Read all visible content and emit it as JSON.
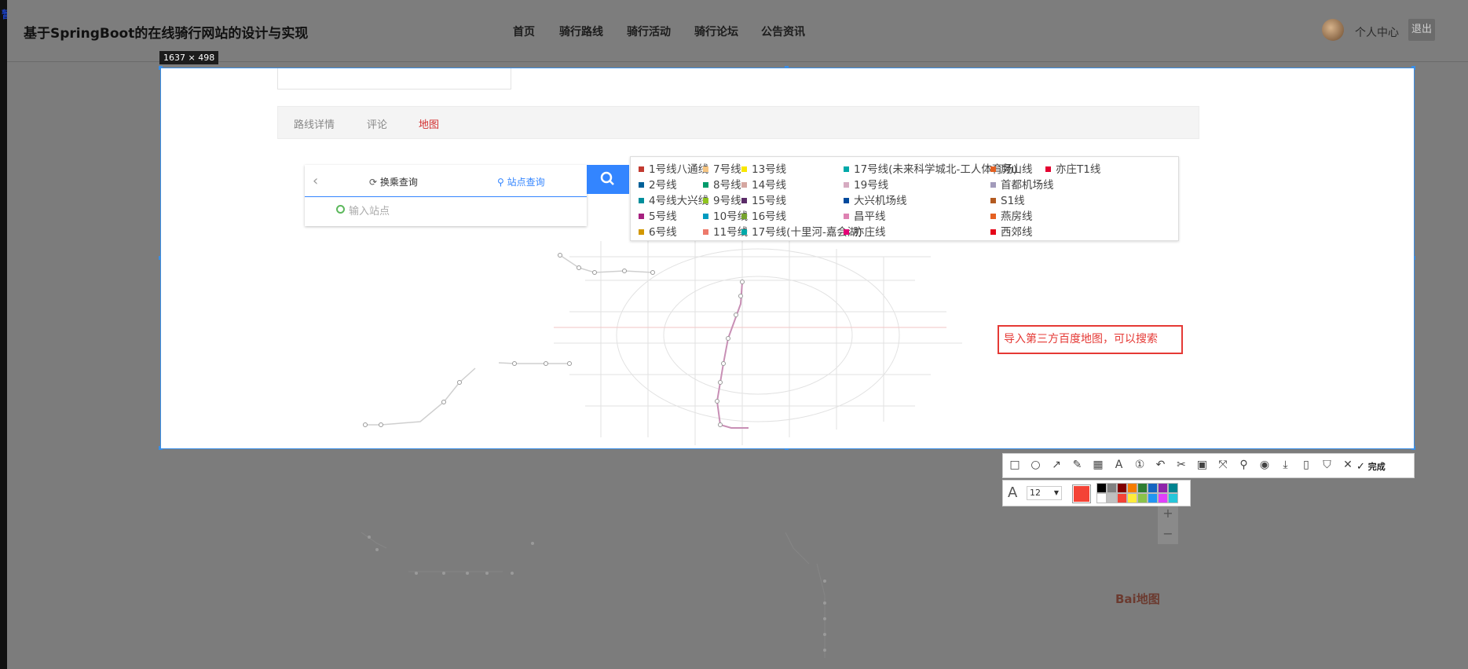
{
  "overlay": {
    "pause_label": "暂停",
    "selection_size": "1637 × 498"
  },
  "header": {
    "site_title": "基于SpringBoot的在线骑行网站的设计与实现",
    "nav": [
      "首页",
      "骑行路线",
      "骑行活动",
      "骑行论坛",
      "公告资讯"
    ],
    "user_center": "个人中心",
    "logout": "退出"
  },
  "detail_tabs": [
    {
      "label": "路线详情",
      "active": false
    },
    {
      "label": "评论",
      "active": false
    },
    {
      "label": "地图",
      "active": true
    }
  ],
  "map_search": {
    "tab_transfer": "换乘查询",
    "tab_station": "站点查询",
    "station_placeholder": "输入站点",
    "search_icon": "search-icon"
  },
  "legend": {
    "columns": [
      [
        {
          "label": "1号线八通线",
          "color": "#c23a30"
        },
        {
          "label": "2号线",
          "color": "#006098"
        },
        {
          "label": "4号线大兴线",
          "color": "#008e9c"
        },
        {
          "label": "5号线",
          "color": "#a6217f"
        },
        {
          "label": "6号线",
          "color": "#d29700"
        }
      ],
      [
        {
          "label": "7号线",
          "color": "#f6c582"
        },
        {
          "label": "8号线",
          "color": "#009b6b"
        },
        {
          "label": "9号线",
          "color": "#8fc31f"
        },
        {
          "label": "10号线",
          "color": "#009bc0"
        },
        {
          "label": "11号线",
          "color": "#ed796b"
        }
      ],
      [
        {
          "label": "13号线",
          "color": "#f9e700"
        },
        {
          "label": "14号线",
          "color": "#d5a7a1"
        },
        {
          "label": "15号线",
          "color": "#5b2c68"
        },
        {
          "label": "16号线",
          "color": "#76a32e"
        },
        {
          "label": "17号线(十里河-嘉会湖)",
          "color": "#00a9a9"
        }
      ],
      [
        {
          "label": "17号线(未来科学城北-工人体育场)",
          "color": "#00a9a9"
        },
        {
          "label": "19号线",
          "color": "#d6abc1"
        },
        {
          "label": "大兴机场线",
          "color": "#004a9d"
        },
        {
          "label": "昌平线",
          "color": "#de82b2"
        },
        {
          "label": "亦庄线",
          "color": "#e40077"
        }
      ],
      [
        {
          "label": "房山线",
          "color": "#e46022"
        },
        {
          "label": "首都机场线",
          "color": "#a29bbb"
        },
        {
          "label": "S1线",
          "color": "#b35a20"
        },
        {
          "label": "燕房线",
          "color": "#e46022"
        },
        {
          "label": "西郊线",
          "color": "#e50619"
        }
      ],
      [
        {
          "label": "亦庄T1线",
          "color": "#e40030"
        }
      ]
    ]
  },
  "annotation_text": "导入第三方百度地图，可以搜索",
  "screenshot_toolbar": {
    "done_label": "完成",
    "font_size": "12",
    "current_color": "#f44336",
    "palette": [
      "#000000",
      "#808080",
      "#800000",
      "#f57c00",
      "#2e7d32",
      "#1565c0",
      "#8e24aa",
      "#00838f",
      "#ffffff",
      "#c0c0c0",
      "#f44336",
      "#ffeb3b",
      "#8bc34a",
      "#2196f3",
      "#e040fb",
      "#26c6da"
    ],
    "icons": [
      "rect-icon",
      "ellipse-icon",
      "arrow-icon",
      "pen-icon",
      "mosaic-icon",
      "text-icon",
      "number-icon",
      "undo-icon",
      "crop-icon",
      "ocr-icon",
      "scroll-capture-icon",
      "pin-icon",
      "record-icon",
      "save-icon",
      "phone-icon",
      "bookmark-icon",
      "close-icon",
      "check-icon"
    ]
  },
  "map": {
    "zoom_in": "+",
    "zoom_out": "−",
    "logo": "Bai地图"
  }
}
